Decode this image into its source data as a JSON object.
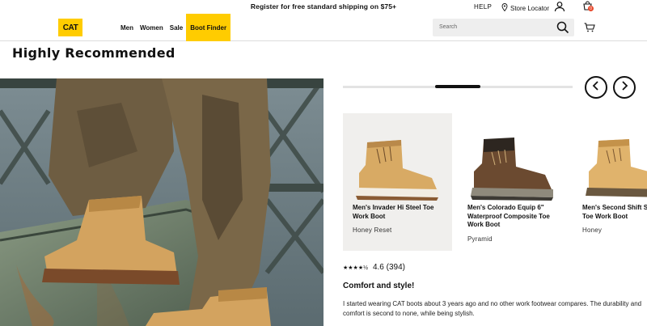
{
  "promo": {
    "text": "Register for free standard shipping on $75+"
  },
  "utility": {
    "help": "HELP",
    "store_locator": "Store Locator",
    "bag_count": "0"
  },
  "brand": {
    "logo": "CAT",
    "accent": "#ffcc00"
  },
  "nav": {
    "items": [
      "Men",
      "Women",
      "Sale",
      "Boot Finder"
    ]
  },
  "search": {
    "placeholder": "Search"
  },
  "section": {
    "title": "Highly Recommended"
  },
  "carousel": {
    "progress": 0.2,
    "cards": [
      {
        "name": "Men's Invader Hi Steel Toe Work Boot",
        "color": "Honey Reset"
      },
      {
        "name": "Men's Colorado Equip 6\" Waterproof Composite Toe Work Boot",
        "color": "Pyramid"
      },
      {
        "name": "Men's Second Shift Steel Toe Work Boot",
        "color": "Honey"
      }
    ]
  },
  "review": {
    "stars": "★★★★½",
    "score": "4.6 (394)",
    "title": "Comfort and style!",
    "body": "I started wearing CAT boots about 3 years ago and no other work footwear compares. The durability and comfort is second to none, while being stylish."
  }
}
